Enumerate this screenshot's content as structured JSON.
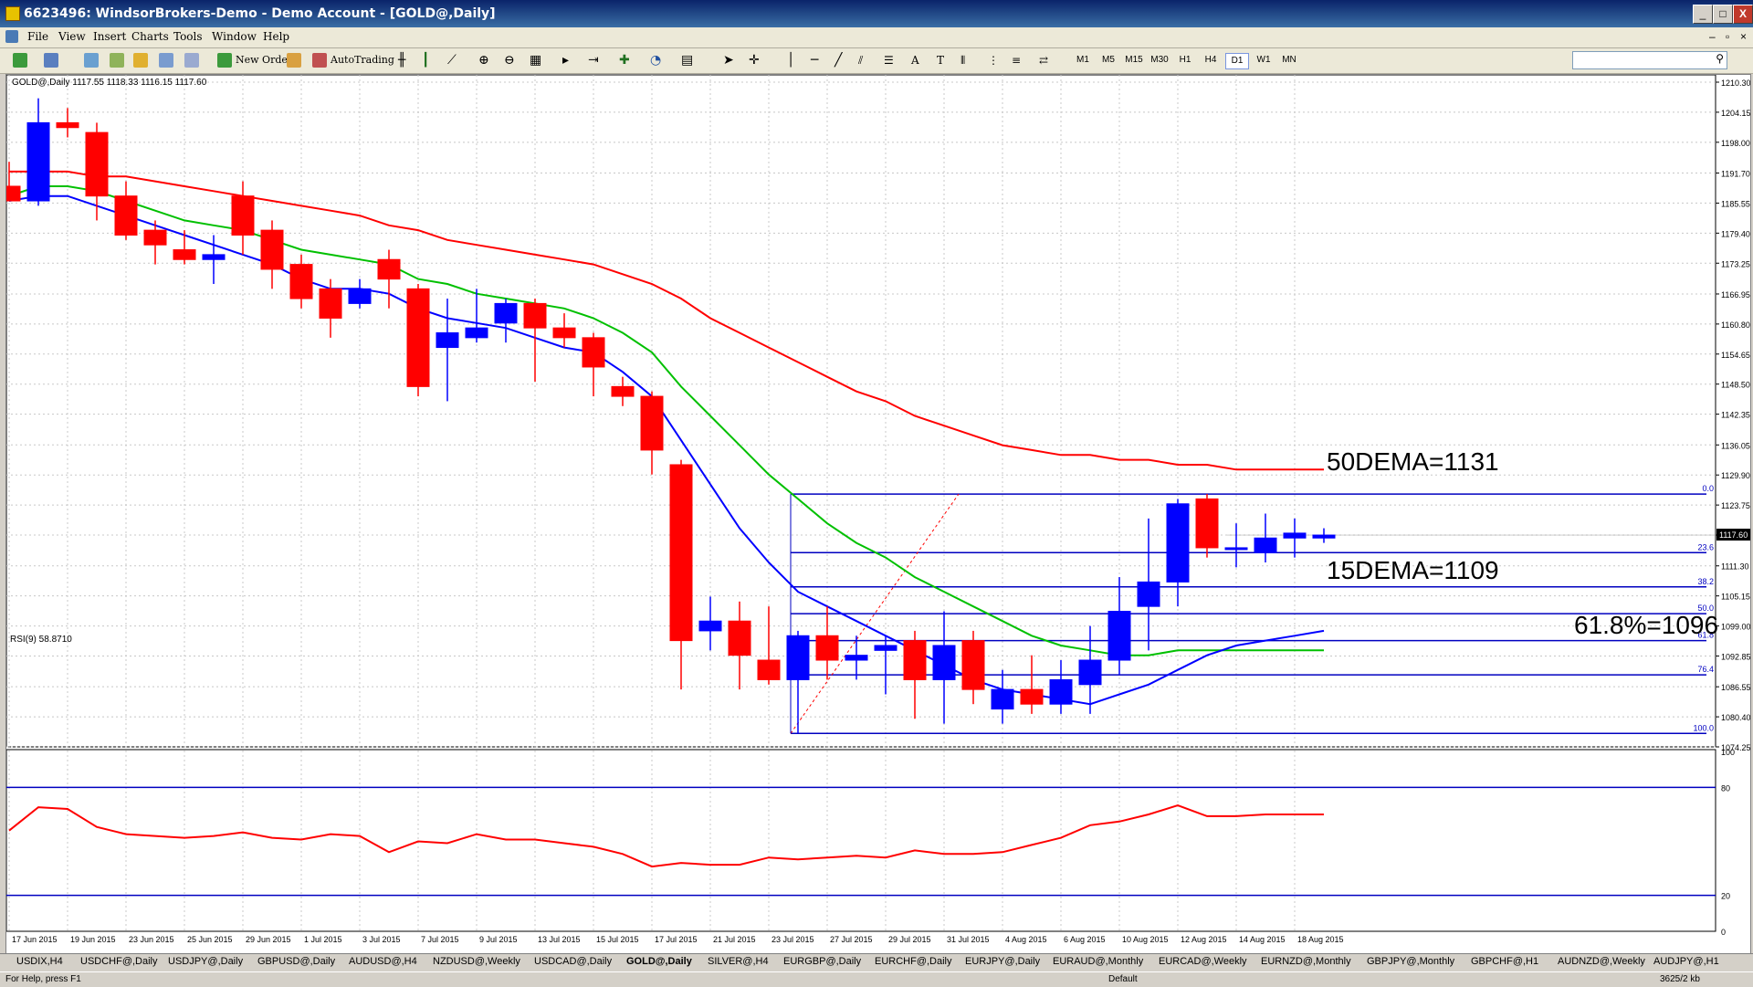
{
  "window": {
    "title": "6623496: WindsorBrokers-Demo - Demo Account - [GOLD@,Daily]",
    "controls": [
      "_",
      "□",
      "X"
    ]
  },
  "menu": [
    "File",
    "View",
    "Insert",
    "Charts",
    "Tools",
    "Window",
    "Help"
  ],
  "toolbar": {
    "new_order_label": "New Order",
    "autotrading_label": "AutoTrading",
    "timeframes": [
      "M1",
      "M5",
      "M15",
      "M30",
      "H1",
      "H4",
      "D1",
      "W1",
      "MN"
    ],
    "active_timeframe": "D1"
  },
  "chart": {
    "header": "GOLD@,Daily  1117.55 1118.33 1116.15 1117.60",
    "current_price": "1117.60",
    "price_axis_labels": [
      "1210.30",
      "1204.15",
      "1198.00",
      "1191.70",
      "1185.55",
      "1179.40",
      "1173.25",
      "1166.95",
      "1160.80",
      "1154.65",
      "1148.50",
      "1142.35",
      "1136.05",
      "1129.90",
      "1123.75",
      "1117.60",
      "1111.30",
      "1105.15",
      "1099.00",
      "1092.85",
      "1086.55",
      "1080.40",
      "1074.25"
    ],
    "date_labels": [
      "17 Jun 2015",
      "19 Jun 2015",
      "23 Jun 2015",
      "25 Jun 2015",
      "29 Jun 2015",
      "1 Jul 2015",
      "3 Jul 2015",
      "7 Jul 2015",
      "9 Jul 2015",
      "13 Jul 2015",
      "15 Jul 2015",
      "17 Jul 2015",
      "21 Jul 2015",
      "23 Jul 2015",
      "27 Jul 2015",
      "29 Jul 2015",
      "31 Jul 2015",
      "4 Aug 2015",
      "6 Aug 2015",
      "10 Aug 2015",
      "12 Aug 2015",
      "14 Aug 2015",
      "18 Aug 2015"
    ],
    "annotations": {
      "dema50": "50DEMA=1131",
      "dema15": "15DEMA=1109",
      "fib618": "61.8%=1096"
    },
    "fib_labels": [
      "0.0",
      "23.6",
      "38.2",
      "50.0",
      "61.8",
      "76.4",
      "100.0"
    ],
    "rsi_header": "RSI(9) 58.8710",
    "rsi_axis_labels": [
      "100",
      "80",
      "20",
      "0"
    ]
  },
  "chart_data": [
    {
      "type": "candlestick",
      "title": "GOLD@,Daily",
      "candles": [
        {
          "o": 1189,
          "h": 1194,
          "l": 1186,
          "c": 1186
        },
        {
          "o": 1186,
          "h": 1207,
          "l": 1185,
          "c": 1202
        },
        {
          "o": 1202,
          "h": 1205,
          "l": 1199,
          "c": 1201
        },
        {
          "o": 1200,
          "h": 1202,
          "l": 1182,
          "c": 1187
        },
        {
          "o": 1187,
          "h": 1190,
          "l": 1178,
          "c": 1179
        },
        {
          "o": 1180,
          "h": 1182,
          "l": 1173,
          "c": 1177
        },
        {
          "o": 1176,
          "h": 1180,
          "l": 1173,
          "c": 1174
        },
        {
          "o": 1174,
          "h": 1179,
          "l": 1169,
          "c": 1175
        },
        {
          "o": 1187,
          "h": 1190,
          "l": 1175,
          "c": 1179
        },
        {
          "o": 1180,
          "h": 1182,
          "l": 1168,
          "c": 1172
        },
        {
          "o": 1173,
          "h": 1175,
          "l": 1164,
          "c": 1166
        },
        {
          "o": 1168,
          "h": 1170,
          "l": 1158,
          "c": 1162
        },
        {
          "o": 1165,
          "h": 1170,
          "l": 1164,
          "c": 1168
        },
        {
          "o": 1174,
          "h": 1176,
          "l": 1164,
          "c": 1170
        },
        {
          "o": 1168,
          "h": 1169,
          "l": 1146,
          "c": 1148
        },
        {
          "o": 1156,
          "h": 1166,
          "l": 1145,
          "c": 1159
        },
        {
          "o": 1158,
          "h": 1168,
          "l": 1157,
          "c": 1160
        },
        {
          "o": 1161,
          "h": 1166,
          "l": 1157,
          "c": 1165
        },
        {
          "o": 1165,
          "h": 1166,
          "l": 1149,
          "c": 1160
        },
        {
          "o": 1160,
          "h": 1163,
          "l": 1156,
          "c": 1158
        },
        {
          "o": 1158,
          "h": 1159,
          "l": 1146,
          "c": 1152
        },
        {
          "o": 1148,
          "h": 1150,
          "l": 1144,
          "c": 1146
        },
        {
          "o": 1146,
          "h": 1147,
          "l": 1130,
          "c": 1135
        },
        {
          "o": 1132,
          "h": 1133,
          "l": 1086,
          "c": 1096
        },
        {
          "o": 1098,
          "h": 1105,
          "l": 1094,
          "c": 1100
        },
        {
          "o": 1100,
          "h": 1104,
          "l": 1086,
          "c": 1093
        },
        {
          "o": 1092,
          "h": 1103,
          "l": 1087,
          "c": 1088
        },
        {
          "o": 1088,
          "h": 1098,
          "l": 1077,
          "c": 1097
        },
        {
          "o": 1097,
          "h": 1103,
          "l": 1088,
          "c": 1092
        },
        {
          "o": 1092,
          "h": 1097,
          "l": 1088,
          "c": 1093
        },
        {
          "o": 1094,
          "h": 1097,
          "l": 1085,
          "c": 1095
        },
        {
          "o": 1096,
          "h": 1098,
          "l": 1080,
          "c": 1088
        },
        {
          "o": 1088,
          "h": 1102,
          "l": 1079,
          "c": 1095
        },
        {
          "o": 1096,
          "h": 1098,
          "l": 1083,
          "c": 1086
        },
        {
          "o": 1082,
          "h": 1090,
          "l": 1079,
          "c": 1086
        },
        {
          "o": 1086,
          "h": 1093,
          "l": 1081,
          "c": 1083
        },
        {
          "o": 1083,
          "h": 1092,
          "l": 1081,
          "c": 1088
        },
        {
          "o": 1087,
          "h": 1099,
          "l": 1081,
          "c": 1092
        },
        {
          "o": 1092,
          "h": 1109,
          "l": 1089,
          "c": 1102
        },
        {
          "o": 1103,
          "h": 1121,
          "l": 1094,
          "c": 1108
        },
        {
          "o": 1108,
          "h": 1125,
          "l": 1103,
          "c": 1124
        },
        {
          "o": 1125,
          "h": 1126,
          "l": 1113,
          "c": 1115
        },
        {
          "o": 1115,
          "h": 1120,
          "l": 1111,
          "c": 1115
        },
        {
          "o": 1114,
          "h": 1122,
          "l": 1112,
          "c": 1117
        },
        {
          "o": 1117,
          "h": 1121,
          "l": 1113,
          "c": 1118
        },
        {
          "o": 1117,
          "h": 1119,
          "l": 1116,
          "c": 1117.6
        }
      ],
      "series": [
        {
          "name": "50DEMA",
          "color": "#ff0000",
          "values": [
            1192,
            1192,
            1192,
            1191,
            1191,
            1190,
            1189,
            1188,
            1187,
            1186,
            1185,
            1184,
            1183,
            1181,
            1180,
            1178,
            1177,
            1176,
            1175,
            1174,
            1173,
            1171,
            1169,
            1166,
            1162,
            1159,
            1156,
            1153,
            1150,
            1147,
            1145,
            1142,
            1140,
            1138,
            1136,
            1135,
            1134,
            1134,
            1133,
            1133,
            1132,
            1132,
            1131,
            1131,
            1131,
            1131
          ]
        },
        {
          "name": "green",
          "color": "#00c000",
          "values": [
            1187,
            1189,
            1189,
            1188,
            1186,
            1184,
            1182,
            1181,
            1180,
            1178,
            1176,
            1175,
            1174,
            1173,
            1170,
            1169,
            1167,
            1166,
            1165,
            1164,
            1162,
            1159,
            1155,
            1148,
            1142,
            1136,
            1130,
            1125,
            1120,
            1116,
            1113,
            1109,
            1106,
            1103,
            1100,
            1097,
            1095,
            1094,
            1093,
            1093,
            1094,
            1094,
            1094,
            1094,
            1094,
            1094
          ]
        },
        {
          "name": "15DEMA",
          "color": "#0000ff",
          "values": [
            1186,
            1187,
            1187,
            1185,
            1183,
            1181,
            1179,
            1177,
            1175,
            1173,
            1170,
            1168,
            1168,
            1167,
            1164,
            1162,
            1161,
            1160,
            1158,
            1156,
            1155,
            1151,
            1146,
            1137,
            1128,
            1119,
            1112,
            1106,
            1103,
            1100,
            1097,
            1094,
            1091,
            1088,
            1086,
            1085,
            1084,
            1083,
            1085,
            1087,
            1090,
            1093,
            1095,
            1096,
            1097,
            1098
          ]
        }
      ],
      "fibonacci": {
        "levels": [
          {
            "label": "0.0",
            "price": 1126
          },
          {
            "label": "23.6",
            "price": 1114
          },
          {
            "label": "38.2",
            "price": 1107
          },
          {
            "label": "50.0",
            "price": 1101.5
          },
          {
            "label": "61.8",
            "price": 1096
          },
          {
            "label": "76.4",
            "price": 1089
          },
          {
            "label": "100.0",
            "price": 1077
          }
        ]
      },
      "ylim": [
        1074.25,
        1210.3
      ]
    },
    {
      "type": "line",
      "title": "RSI(9) 58.8710",
      "series": [
        {
          "color": "#ff0000",
          "values": [
            56,
            69,
            68,
            58,
            54,
            53,
            52,
            53,
            55,
            52,
            51,
            54,
            53,
            44,
            50,
            49,
            54,
            51,
            51,
            49,
            47,
            43,
            36,
            38,
            37,
            37,
            41,
            40,
            41,
            42,
            41,
            45,
            43,
            43,
            44,
            48,
            52,
            59,
            61,
            65,
            70,
            64,
            64,
            65,
            65,
            65
          ]
        }
      ],
      "reference_lines": [
        80,
        20
      ],
      "ylim": [
        0,
        100
      ]
    }
  ]
}
